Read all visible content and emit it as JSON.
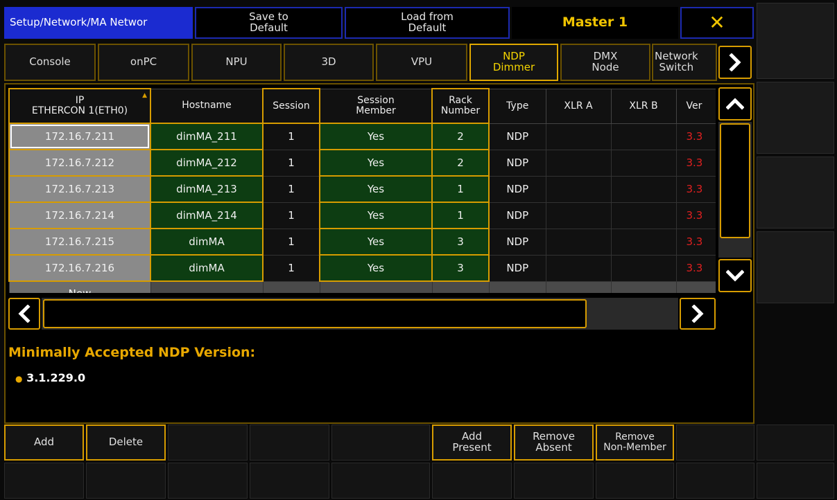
{
  "header": {
    "title": "Setup/Network/MA Networ",
    "save_default": "Save to\nDefault",
    "load_default": "Load from\nDefault",
    "master": "Master 1",
    "close_glyph": "✕"
  },
  "tabs": [
    {
      "label": "Console"
    },
    {
      "label": "onPC"
    },
    {
      "label": "NPU"
    },
    {
      "label": "3D"
    },
    {
      "label": "VPU"
    },
    {
      "label": "NDP\nDimmer"
    },
    {
      "label": "DMX\nNode"
    },
    {
      "label": "Network\nSwitch"
    }
  ],
  "table": {
    "columns": [
      "IP\nETHERCON 1(ETH0)",
      "Hostname",
      "Session",
      "Session\nMember",
      "Rack\nNumber",
      "Type",
      "XLR A",
      "XLR B",
      "Ver"
    ],
    "rows": [
      {
        "ip": "172.16.7.211",
        "host": "dimMA_211",
        "session": "1",
        "member": "Yes",
        "rack": "2",
        "type": "NDP",
        "xlra": "",
        "xlrb": "",
        "ver": "3.3"
      },
      {
        "ip": "172.16.7.212",
        "host": "dimMA_212",
        "session": "1",
        "member": "Yes",
        "rack": "2",
        "type": "NDP",
        "xlra": "",
        "xlrb": "",
        "ver": "3.3"
      },
      {
        "ip": "172.16.7.213",
        "host": "dimMA_213",
        "session": "1",
        "member": "Yes",
        "rack": "1",
        "type": "NDP",
        "xlra": "",
        "xlrb": "",
        "ver": "3.3"
      },
      {
        "ip": "172.16.7.214",
        "host": "dimMA_214",
        "session": "1",
        "member": "Yes",
        "rack": "1",
        "type": "NDP",
        "xlra": "",
        "xlrb": "",
        "ver": "3.3"
      },
      {
        "ip": "172.16.7.215",
        "host": "dimMA",
        "session": "1",
        "member": "Yes",
        "rack": "3",
        "type": "NDP",
        "xlra": "",
        "xlrb": "",
        "ver": "3.3"
      },
      {
        "ip": "172.16.7.216",
        "host": "dimMA",
        "session": "1",
        "member": "Yes",
        "rack": "3",
        "type": "NDP",
        "xlra": "",
        "xlrb": "",
        "ver": "3.3"
      }
    ],
    "new_label": "New"
  },
  "info": {
    "heading": "Minimally Accepted NDP Version:",
    "bullet": "●",
    "version": "3.1.229.0"
  },
  "bottom": {
    "add": "Add",
    "delete": "Delete",
    "add_present": "Add\nPresent",
    "remove_absent": "Remove\nAbsent",
    "remove_nonmember": "Remove\nNon-Member"
  },
  "colors": {
    "accent": "#d79c00",
    "header_blue": "#1b2bd0",
    "member_green": "#0d3d12",
    "version_red": "#e02020"
  }
}
